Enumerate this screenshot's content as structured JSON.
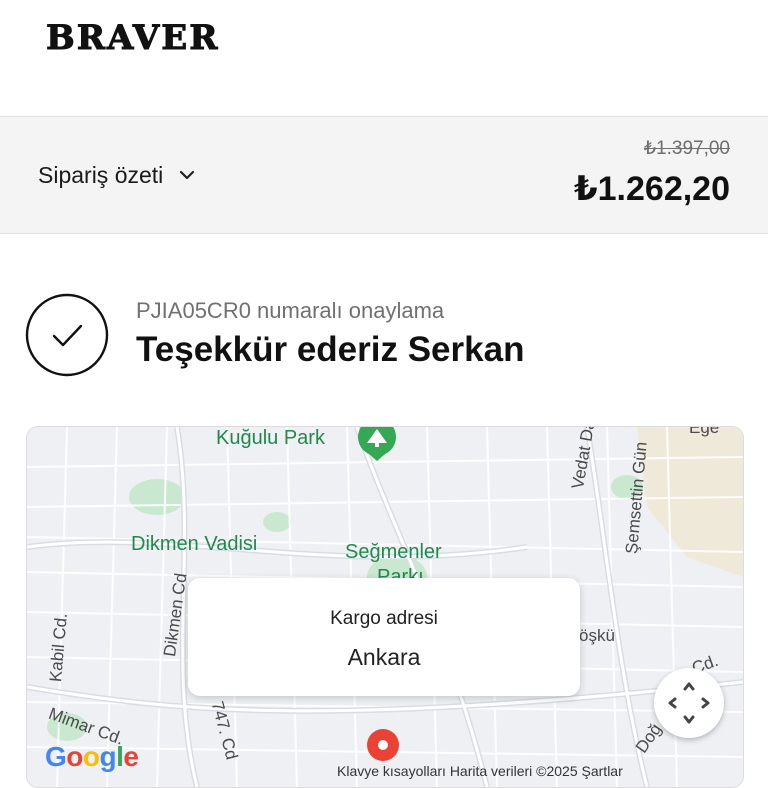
{
  "brand": {
    "logo_text": "BRAVER"
  },
  "order_summary": {
    "toggle_label": "Sipariş özeti",
    "original_price": "₺1.397,00",
    "total_price": "₺1.262,20"
  },
  "confirmation": {
    "number_text": "PJIA05CR0 numaralı onaylama",
    "thank_you": "Teşekkür ederiz Serkan"
  },
  "map": {
    "labels": {
      "kugulu_park": "Kuğulu Park",
      "dikmen_vadisi": "Dikmen Vadisi",
      "segmenler_1": "Seğmenler",
      "segmenler_2": "Parkı",
      "vedat_da": "Vedat Da",
      "semsettin": "Şemsettin Gün",
      "ege": "Ege",
      "dikmen_cd": "Dikmen Cd",
      "kabil_cd": "Kabil Cd.",
      "mimar_cd": "Mimar Cd.",
      "cd_747": "747. Cd",
      "koskü": "öşkü",
      "cd_right": "Cd.",
      "doga": "Doğ"
    },
    "shipping_card": {
      "label": "Kargo adresi",
      "city": "Ankara"
    },
    "google_logo": "Google",
    "attribution": "Klavye kısayolları   Harita verileri ©2025   Şartlar",
    "colors": {
      "park_green": "#c9e8cf",
      "road": "#ffffff",
      "marker_red": "#ea4335"
    }
  }
}
